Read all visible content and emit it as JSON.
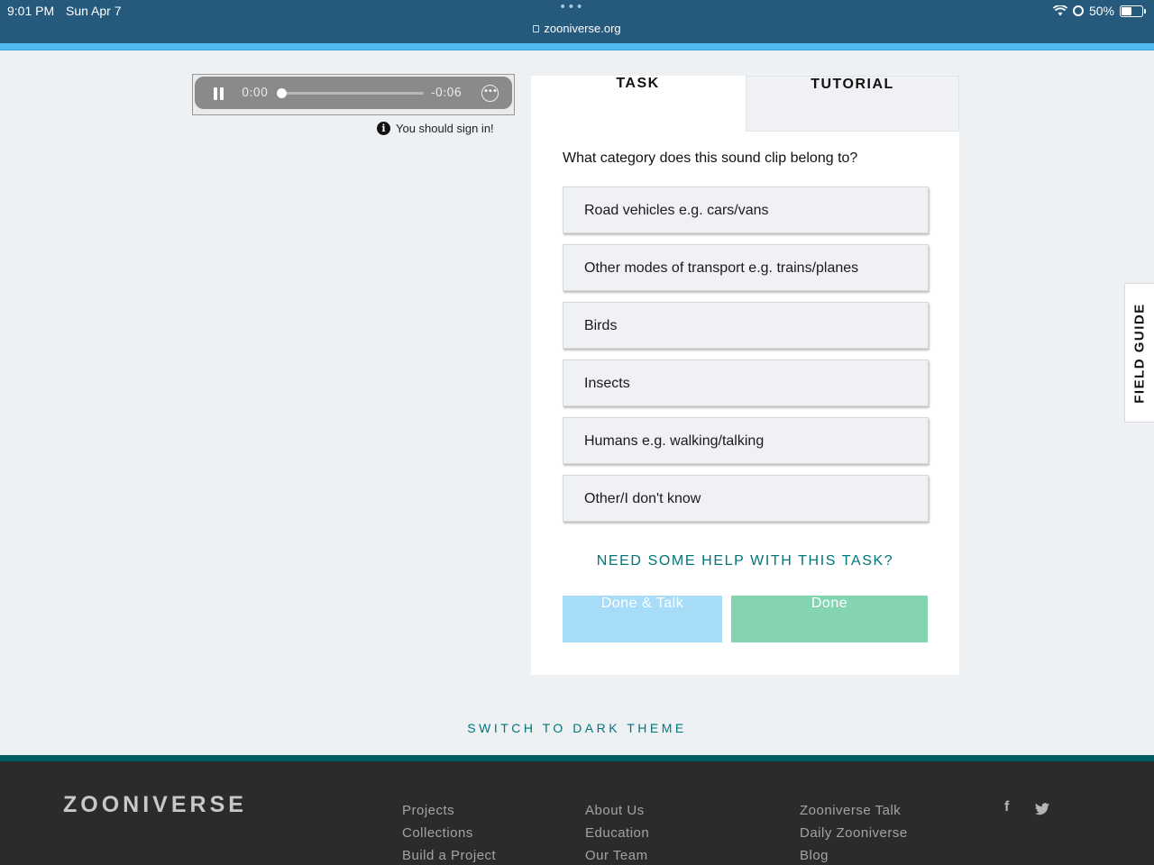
{
  "statusbar": {
    "time": "9:01 PM",
    "date": "Sun Apr 7",
    "url": "zooniverse.org",
    "battery_text": "50%",
    "battery_level": 0.5
  },
  "audio": {
    "current_time": "0:00",
    "remaining_time": "-0:06",
    "progress": 0.0,
    "signin_text": "You should sign in!"
  },
  "tabs": {
    "task": "TASK",
    "tutorial": "TUTORIAL"
  },
  "task": {
    "question": "What category does this sound clip belong to?",
    "answers": [
      "Road vehicles e.g. cars/vans",
      "Other modes of transport e.g. trains/planes",
      "Birds",
      "Insects",
      "Humans e.g. walking/talking",
      "Other/I don't know"
    ],
    "help_link": "NEED SOME HELP WITH THIS TASK?",
    "done_talk_label": "Done & Talk",
    "done_label": "Done"
  },
  "field_guide_label": "FIELD GUIDE",
  "dark_theme_link": "SWITCH TO DARK THEME",
  "footer": {
    "logo": "ZOONIVERSE",
    "col1": [
      "Projects",
      "Collections",
      "Build a Project"
    ],
    "col2": [
      "About Us",
      "Education",
      "Our Team"
    ],
    "col3": [
      "Zooniverse Talk",
      "Daily Zooniverse",
      "Blog"
    ],
    "social": [
      {
        "icon": "facebook-icon",
        "glyph": "f"
      },
      {
        "icon": "twitter-icon",
        "glyph": "t"
      }
    ]
  },
  "colors": {
    "status_bar": "#265a7c",
    "header_accent": "#50b9ef",
    "teal_link": "#00757a",
    "done_talk_bg": "#a6dcf8",
    "done_bg": "#84d4b2",
    "footer_bg": "#2b2b2b"
  }
}
